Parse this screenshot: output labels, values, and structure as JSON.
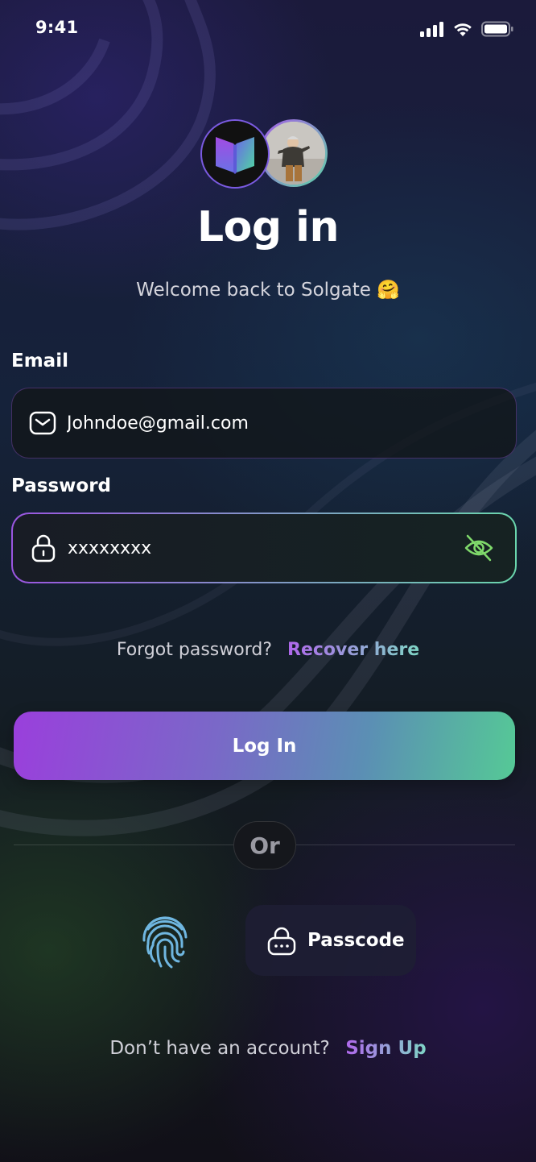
{
  "status_bar": {
    "time": "9:41"
  },
  "header": {
    "title": "Log in",
    "subtitle": "Welcome back to Solgate 🤗"
  },
  "form": {
    "email": {
      "label": "Email",
      "value": "Johndoe@gmail.com"
    },
    "password": {
      "label": "Password",
      "value": "xxxxxxxx"
    }
  },
  "recover": {
    "prompt": "Forgot password?",
    "link": "Recover here"
  },
  "login_button": {
    "label": "Log In"
  },
  "divider": {
    "label": "Or"
  },
  "alt_auth": {
    "passcode_label": "Passcode"
  },
  "signup": {
    "prompt": "Don’t have an account?",
    "link": "Sign Up"
  },
  "colors": {
    "accent_purple": "#a45de6",
    "accent_green": "#5fd3a7",
    "eye_icon": "#7fd96b",
    "fingerprint": "#6fb6e0"
  },
  "icons": [
    "signal-icon",
    "wifi-icon",
    "battery-icon",
    "app-logo",
    "mail-icon",
    "lock-icon",
    "eye-off-icon",
    "fingerprint-icon",
    "passcode-lock-icon"
  ]
}
